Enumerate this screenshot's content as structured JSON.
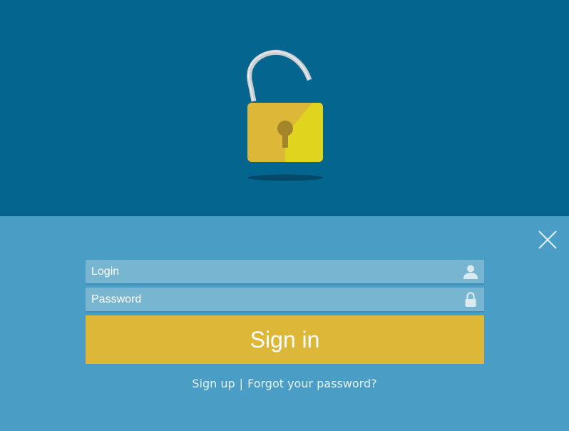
{
  "colors": {
    "top_panel": "#04658f",
    "bottom_panel": "#4a9ec5",
    "input_bg": "#77b5d1",
    "signin_button": "#ddb838",
    "lock_body": "#ddb838",
    "lock_highlight": "#e1d41f",
    "lock_keyhole": "#a4862a",
    "lock_shackle": "#c9ced3"
  },
  "icons": {
    "illustration": "open-padlock-icon",
    "close": "close-icon",
    "login": "user-icon",
    "password": "lock-icon"
  },
  "form": {
    "login_placeholder": "Login",
    "password_placeholder": "Password",
    "signin_label": "Sign in"
  },
  "links": {
    "signup": "Sign up",
    "separator": "|",
    "forgot": "Forgot your password?"
  }
}
